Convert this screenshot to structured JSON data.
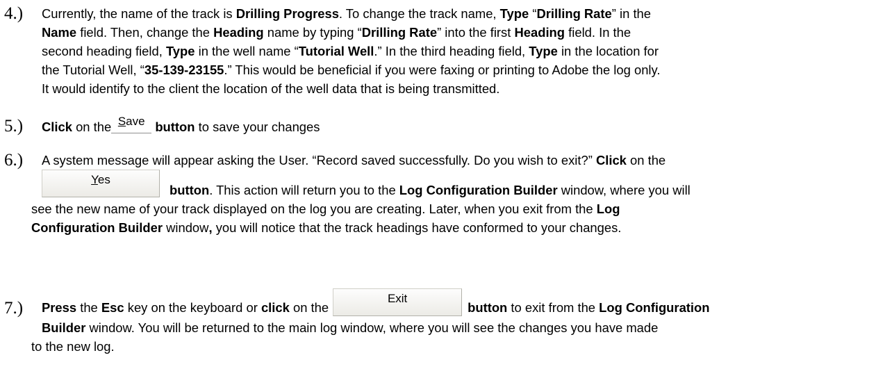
{
  "steps": [
    {
      "number": "4.)",
      "lines": [
        [
          {
            "t": "Currently, the name of the track is ",
            "b": false
          },
          {
            "t": "Drilling Progress",
            "b": true
          },
          {
            "t": ". To change the track name, ",
            "b": false
          },
          {
            "t": "Type",
            "b": true
          },
          {
            "t": " “",
            "b": false
          },
          {
            "t": "Drilling Rate",
            "b": true
          },
          {
            "t": "” in the",
            "b": false
          }
        ],
        [
          {
            "t": "Name",
            "b": true
          },
          {
            "t": " field. Then, change the ",
            "b": false
          },
          {
            "t": "Heading",
            "b": true
          },
          {
            "t": " name by typing “",
            "b": false
          },
          {
            "t": "Drilling Rate",
            "b": true
          },
          {
            "t": "” into the first ",
            "b": false
          },
          {
            "t": "Heading",
            "b": true
          },
          {
            "t": " field. In the",
            "b": false
          }
        ],
        [
          {
            "t": "second heading field, ",
            "b": false
          },
          {
            "t": "Type",
            "b": true
          },
          {
            "t": " in the well name “",
            "b": false
          },
          {
            "t": "Tutorial Well",
            "b": true
          },
          {
            "t": ".” In the third heading field, ",
            "b": false
          },
          {
            "t": "Type",
            "b": true
          },
          {
            "t": " in the location for",
            "b": false
          }
        ],
        [
          {
            "t": "the Tutorial Well, “",
            "b": false
          },
          {
            "t": "35-139-23155",
            "b": true
          },
          {
            "t": ".” This would be beneficial if you were faxing or printing to Adobe the log only.",
            "b": false
          }
        ],
        [
          {
            "t": "It would identify to the client the location of the well data that is being transmitted.",
            "b": false
          }
        ]
      ]
    },
    {
      "number": "5.)",
      "pre": [
        {
          "t": "Click",
          "b": true
        },
        {
          "t": " on the",
          "b": false
        }
      ],
      "button": {
        "label_u": "S",
        "label_rest": "ave"
      },
      "post": [
        {
          "t": " button",
          "b": true
        },
        {
          "t": " to save your changes",
          "b": false
        }
      ]
    },
    {
      "number": "6.)",
      "line1": [
        {
          "t": "A system message will appear asking the User. “Record saved successfully. Do you wish to exit?” ",
          "b": false
        },
        {
          "t": "Click",
          "b": true
        },
        {
          "t": " on the",
          "b": false
        }
      ],
      "button": {
        "label_u": "Y",
        "label_rest": "es"
      },
      "after_button": [
        {
          "t": "button",
          "b": true
        },
        {
          "t": ". This action will return you to the ",
          "b": false
        },
        {
          "t": "Log Configuration Builder",
          "b": true
        },
        {
          "t": " window, where you will",
          "b": false
        }
      ],
      "line3": [
        {
          "t": "see the new name of your track displayed on the log you are creating. Later, when you exit from the ",
          "b": false
        },
        {
          "t": "Log",
          "b": true
        }
      ],
      "line4": [
        {
          "t": "Configuration Builder",
          "b": true
        },
        {
          "t": " window",
          "b": false
        },
        {
          "t": ",",
          "b": true
        },
        {
          "t": " you will notice that the track headings have conformed to your changes.",
          "b": false
        }
      ]
    },
    {
      "number": "7.)",
      "line1_pre": [
        {
          "t": "Press",
          "b": true
        },
        {
          "t": " the ",
          "b": false
        },
        {
          "t": "Esc",
          "b": true
        },
        {
          "t": " key on the keyboard or ",
          "b": false
        },
        {
          "t": "click",
          "b": true
        },
        {
          "t": " on the",
          "b": false
        }
      ],
      "button": {
        "label": "Exit"
      },
      "line1_post": [
        {
          "t": "button",
          "b": true
        },
        {
          "t": " to exit from the ",
          "b": false
        },
        {
          "t": "Log Configuration",
          "b": true
        }
      ],
      "line2": [
        {
          "t": "Builder",
          "b": true
        },
        {
          "t": " window. You will be returned to the main log window, where you will see the changes you have made",
          "b": false
        }
      ],
      "line3": [
        {
          "t": "to the new log.",
          "b": false
        }
      ]
    }
  ]
}
